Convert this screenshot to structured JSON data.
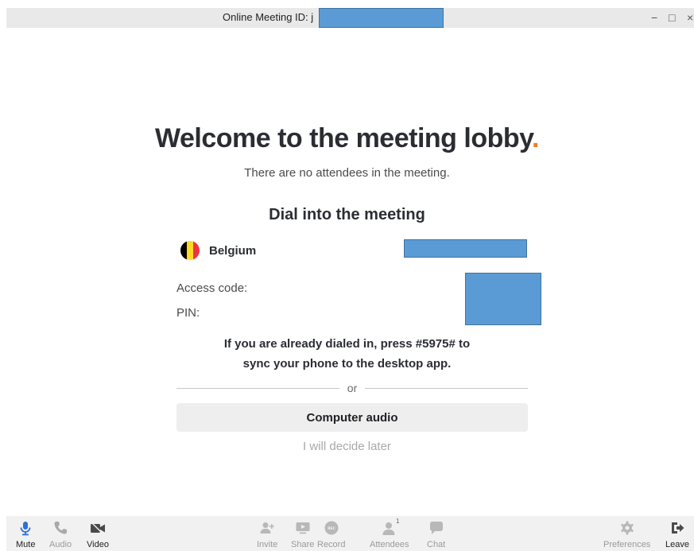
{
  "window": {
    "title": "Online Meeting ID: j",
    "minimize": "−",
    "maximize": "□",
    "close": "×"
  },
  "lobby": {
    "heading": "Welcome to the meeting lobby",
    "heading_dot": ".",
    "subtitle": "There are no attendees in the meeting."
  },
  "dial": {
    "heading": "Dial into the meeting",
    "country": "Belgium",
    "access_code_label": "Access code:",
    "pin_label": "PIN:",
    "sync_line1": "If you are already dialed in, press #5975# to",
    "sync_line2": "sync your phone to the desktop app.",
    "or": "or",
    "computer_audio": "Computer audio",
    "decide_later": "I will decide later"
  },
  "toolbar": {
    "mute": "Mute",
    "audio": "Audio",
    "video": "Video",
    "invite": "Invite",
    "share": "Share",
    "record": "Record",
    "record_badge": "REC",
    "attendees": "Attendees",
    "attendees_count": "1",
    "chat": "Chat",
    "preferences": "Preferences",
    "leave": "Leave"
  },
  "colors": {
    "accent_orange": "#ef7d1f",
    "mic_blue": "#2e6fd8",
    "flag_black": "#000000",
    "flag_yellow": "#fdda24",
    "flag_red": "#ef3340"
  }
}
